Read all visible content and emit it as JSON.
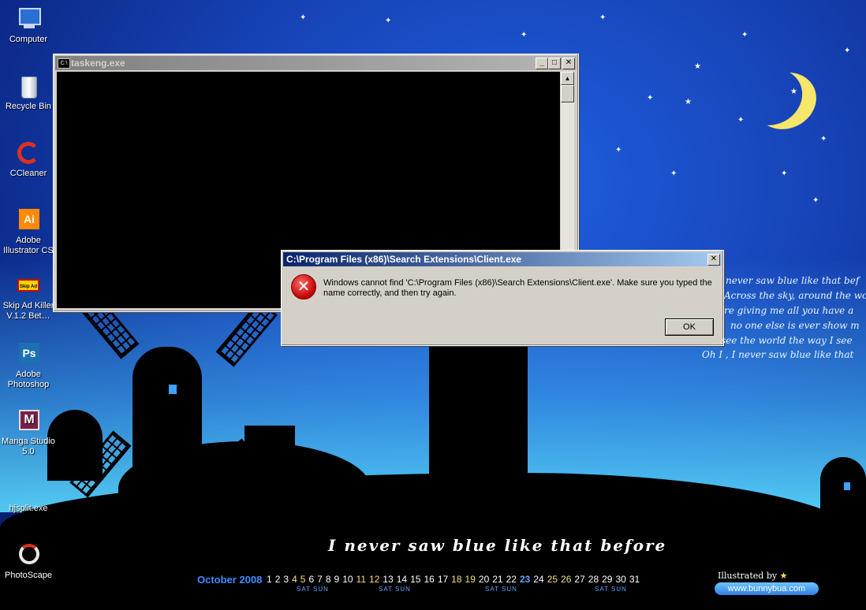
{
  "desktop_icons": [
    {
      "label": "Computer",
      "icon": "computer-icon"
    },
    {
      "label": "Recycle Bin",
      "icon": "recycle-bin-icon"
    },
    {
      "label": "CCleaner",
      "icon": "ccleaner-icon"
    },
    {
      "label": "Adobe Illustrator CS",
      "icon": "illustrator-icon"
    },
    {
      "label": "Skip Ad Killer V.1.2 Bet…",
      "icon": "skip-ad-icon"
    },
    {
      "label": "Adobe Photoshop",
      "icon": "photoshop-icon"
    },
    {
      "label": "Manga Studio 5.0",
      "icon": "manga-studio-icon"
    },
    {
      "label": "hjsplit.exe",
      "icon": "hjsplit-icon"
    },
    {
      "label": "PhotoScape",
      "icon": "photoscape-icon"
    }
  ],
  "icon_glyphs": {
    "illustrator": "Ai",
    "photoshop": "Ps",
    "manga": "M",
    "skip_ad": "Skip Ad"
  },
  "console_window": {
    "title": "taskeng.exe",
    "sys_icon": "C:\\",
    "minimize": "_",
    "maximize": "□",
    "close": "✕"
  },
  "error_dialog": {
    "title": "C:\\Program Files (x86)\\Search Extensions\\Client.exe",
    "close": "✕",
    "icon": "error-x-icon",
    "icon_glyph": "✕",
    "message": "Windows cannot find 'C:\\Program Files (x86)\\Search Extensions\\Client.exe'. Make sure you typed the name correctly, and then try again.",
    "ok_label": "OK"
  },
  "wallpaper": {
    "lyrics": [
      "never saw blue like that bef",
      "Across the sky, around the wo",
      "re giving me all you have a",
      "no one else is ever show m",
      "see the world the way I see",
      "Oh I , I never saw blue like that"
    ],
    "tagline": "I never saw blue like that before",
    "calendar": {
      "month": "October 2008",
      "days": [
        "1",
        "2",
        "3",
        "4",
        "5",
        "6",
        "7",
        "8",
        "9",
        "10",
        "11",
        "12",
        "13",
        "14",
        "15",
        "16",
        "17",
        "18",
        "19",
        "20",
        "21",
        "22",
        "23",
        "24",
        "25",
        "26",
        "27",
        "28",
        "29",
        "30",
        "31"
      ],
      "weekend_days": [
        "4",
        "5",
        "11",
        "12",
        "18",
        "19",
        "25",
        "26"
      ],
      "today": "23",
      "weekend_label": "SAT SUN"
    },
    "credit": "Illustrated by",
    "url": "www.bunnybua.com",
    "colors": {
      "sky": "#1744b8",
      "moon": "#f6e66a",
      "accent": "#3f8cff"
    }
  }
}
